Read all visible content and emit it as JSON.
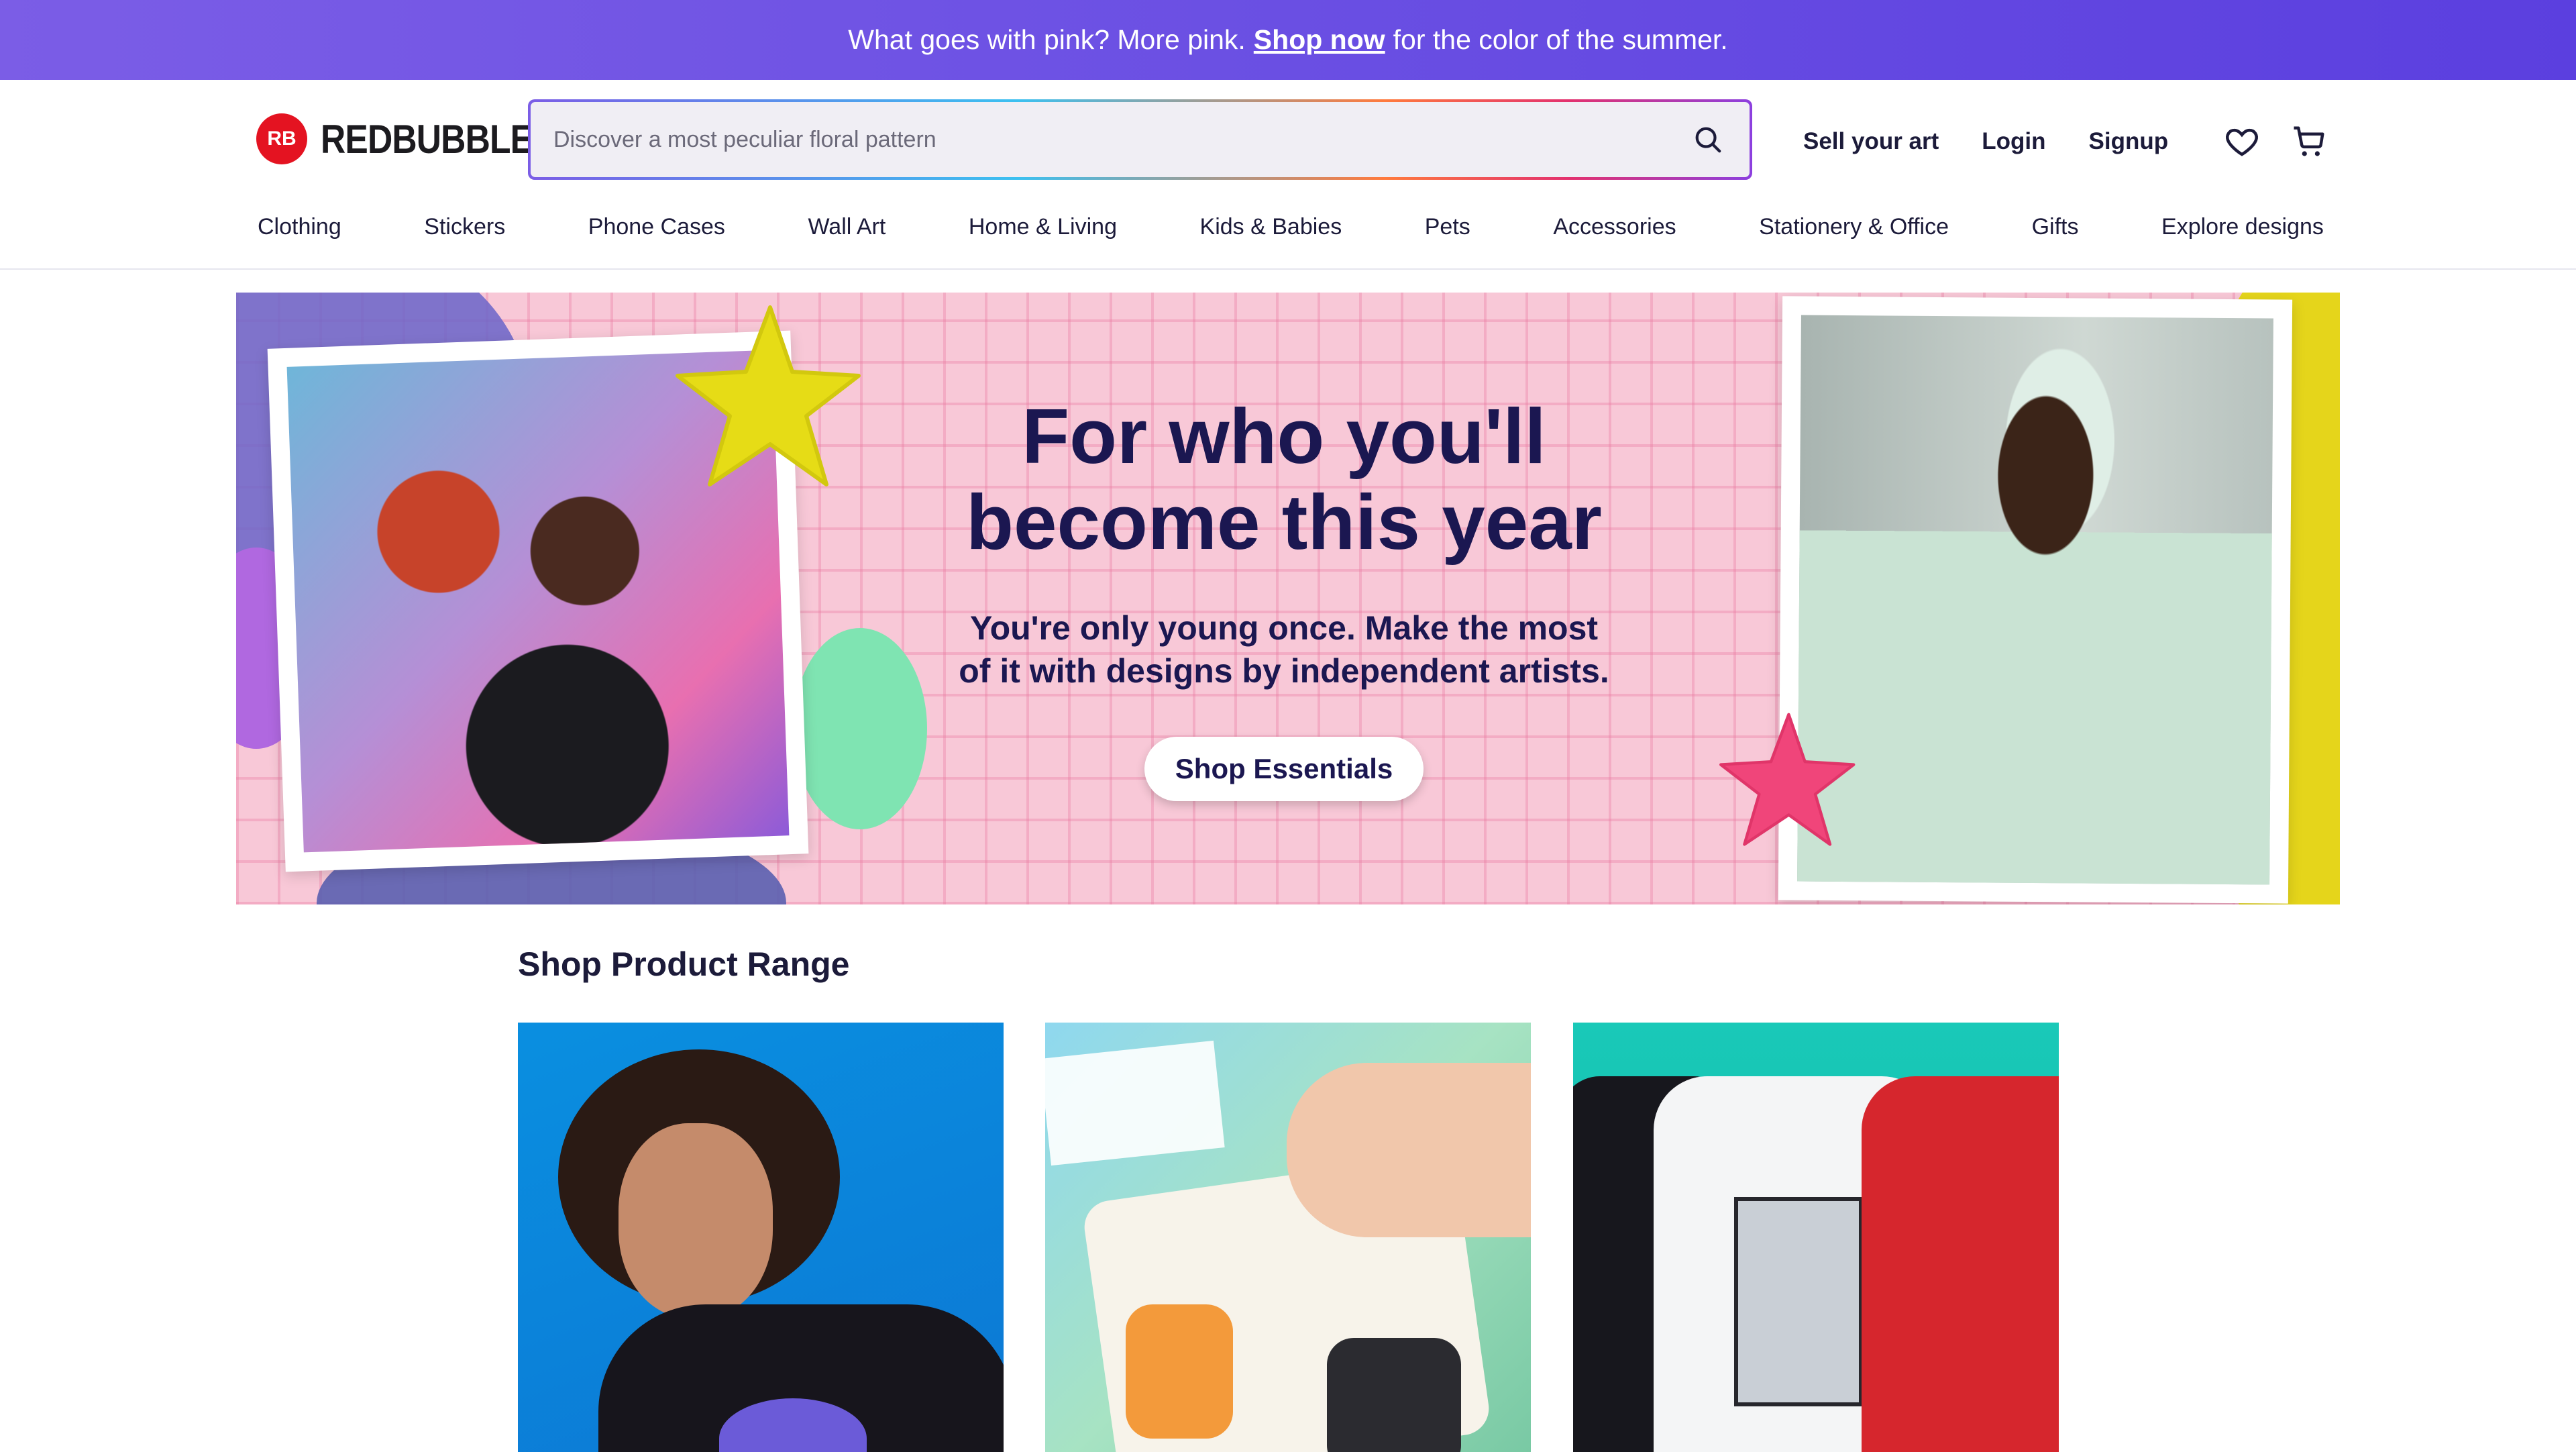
{
  "promo": {
    "text_before": "What goes with pink? More pink.",
    "link": "Shop now",
    "text_after": "for the color of the summer."
  },
  "header": {
    "logo_mark": "RB",
    "logo_text": "REDBUBBLE",
    "search_placeholder": "Discover a most peculiar floral pattern",
    "links": {
      "sell": "Sell your art",
      "login": "Login",
      "signup": "Signup"
    },
    "icons": [
      "heart-icon",
      "cart-icon",
      "search-icon"
    ]
  },
  "nav": [
    "Clothing",
    "Stickers",
    "Phone Cases",
    "Wall Art",
    "Home & Living",
    "Kids & Babies",
    "Pets",
    "Accessories",
    "Stationery & Office",
    "Gifts",
    "Explore designs"
  ],
  "hero": {
    "title_line1": "For who you'll",
    "title_line2": "become this year",
    "subtitle_line1": "You're only young once. Make the most",
    "subtitle_line2": "of it with designs by independent artists.",
    "button": "Shop Essentials"
  },
  "product_range": {
    "title": "Shop Product Range",
    "tiles": [
      {
        "name": "hoodie-tile"
      },
      {
        "name": "stickers-tile"
      },
      {
        "name": "tshirts-tile"
      }
    ]
  },
  "colors": {
    "promo_start": "#7b5de6",
    "promo_end": "#5b3fdf",
    "brand_red": "#e41321",
    "heading": "#1b1751",
    "hero_bg": "#f8c8d7"
  }
}
